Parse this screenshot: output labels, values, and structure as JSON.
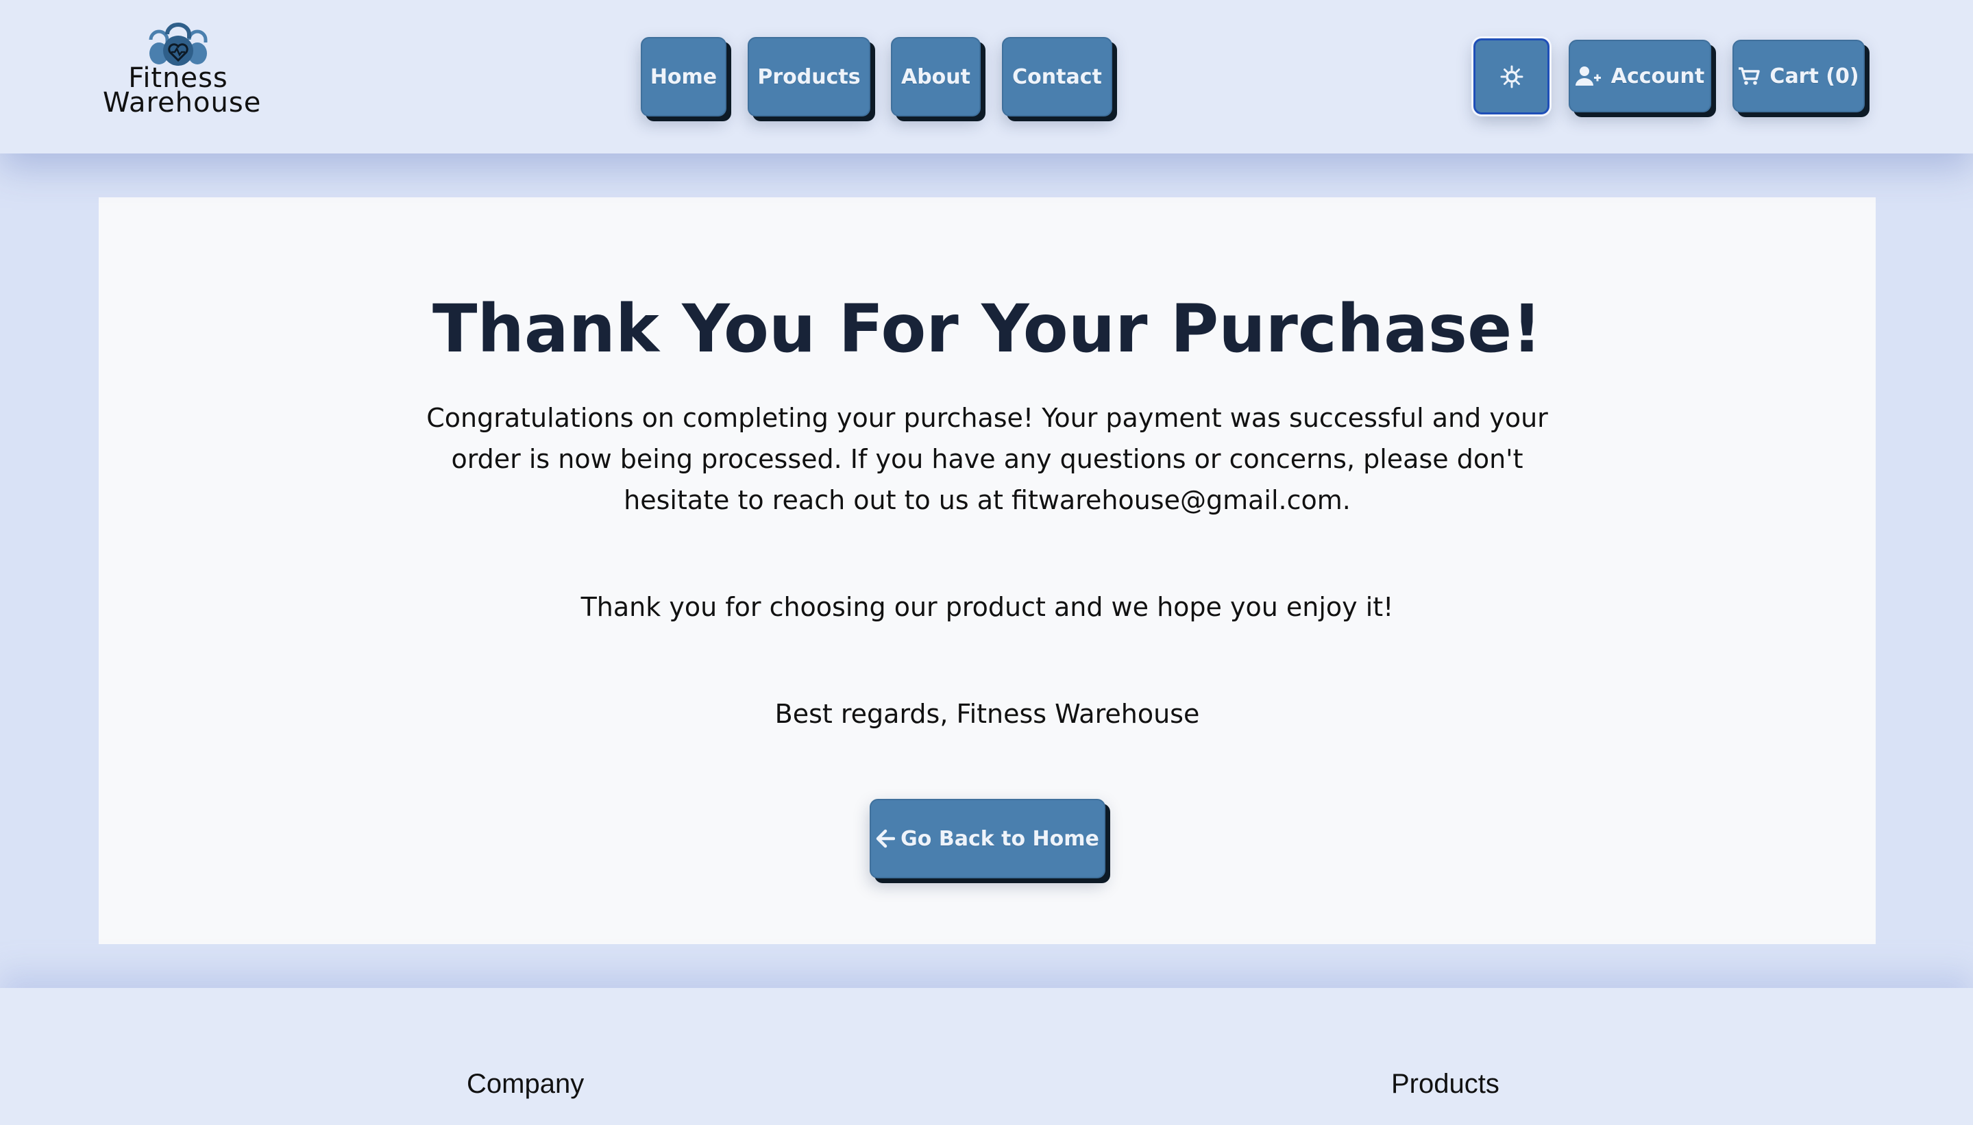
{
  "logo": {
    "line1": "Fitness",
    "line2": "Warehouse"
  },
  "nav": {
    "home": "Home",
    "products": "Products",
    "about": "About",
    "contact": "Contact"
  },
  "header_actions": {
    "theme_icon": "sun-icon",
    "account": "Account",
    "account_icon": "user-plus-icon",
    "cart": "Cart (0)",
    "cart_icon": "cart-icon"
  },
  "main": {
    "title": "Thank You For Your Purchase!",
    "paragraph1": "Congratulations on completing your purchase! Your payment was successful and your order is now being processed. If you have any questions or concerns, please don't hesitate to reach out to us at fitwarehouse@gmail.com.",
    "paragraph2": "Thank you for choosing our product and we hope you enjoy it!",
    "paragraph3": "Best regards, Fitness Warehouse",
    "back_button": "Go Back to Home",
    "back_icon": "arrow-left-icon"
  },
  "footer": {
    "company_heading": "Company",
    "products_heading": "Products"
  },
  "colors": {
    "page_bg": "#d9e2f6",
    "header_bg": "#e2e9f8",
    "button_bg": "#4a7fae",
    "card_bg": "#f8f9fb",
    "title_text": "#182338"
  }
}
